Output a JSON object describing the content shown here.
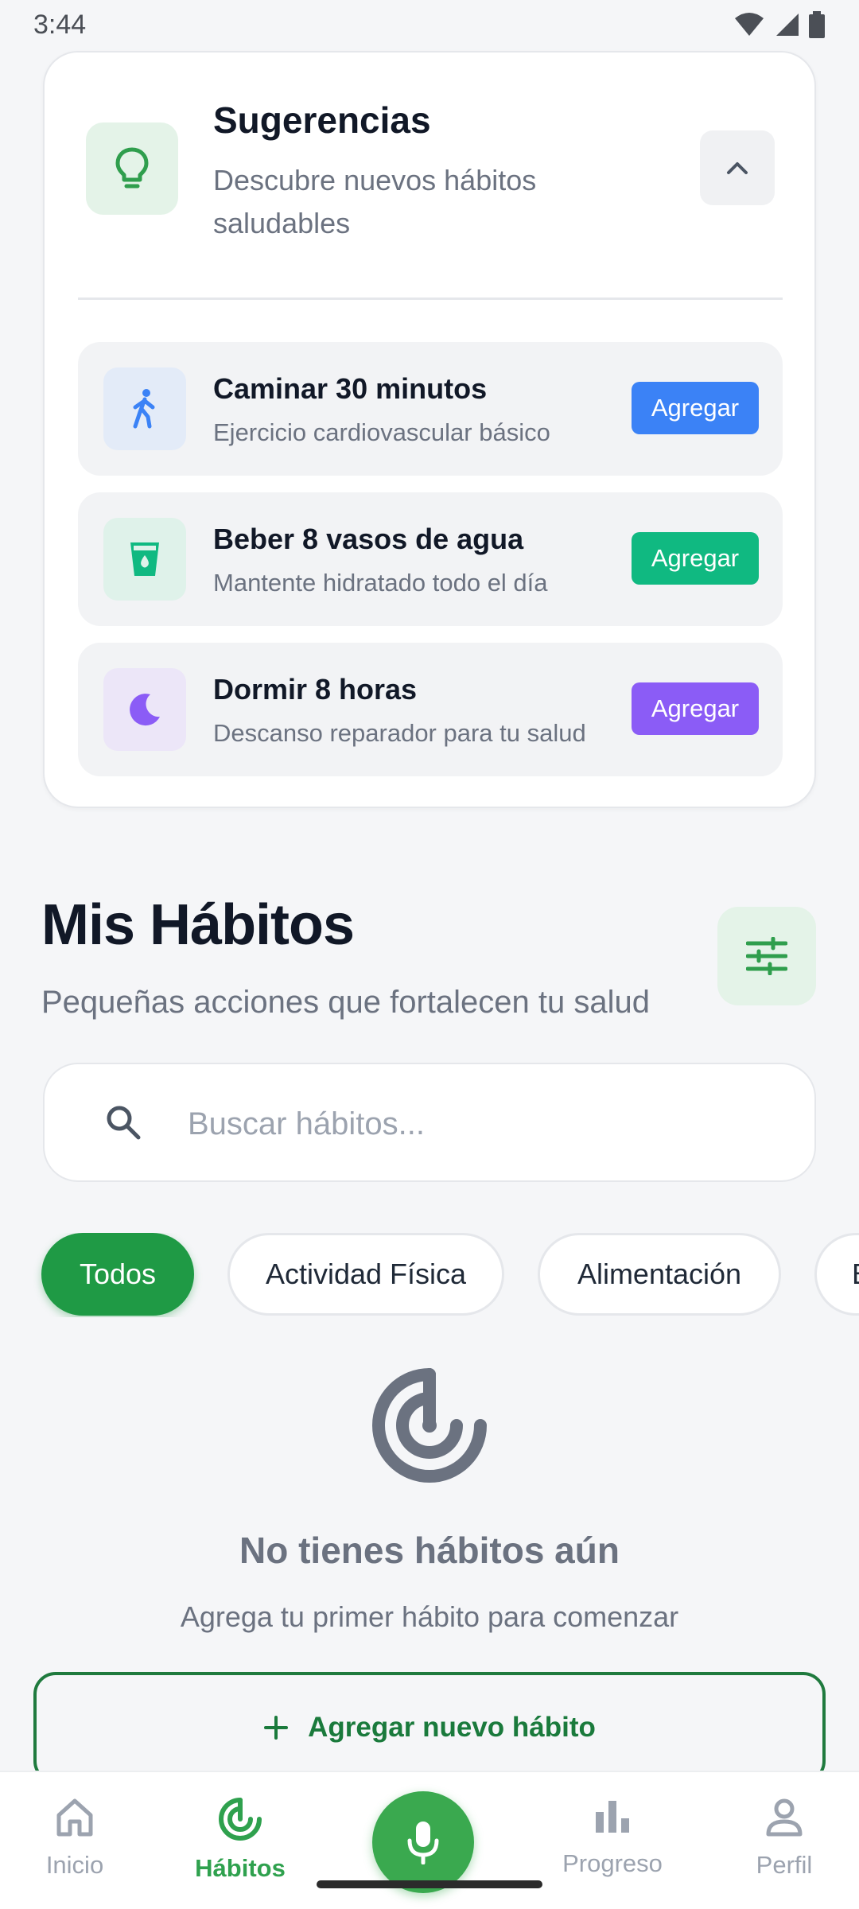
{
  "status_bar": {
    "time": "3:44"
  },
  "suggestions": {
    "title": "Sugerencias",
    "subtitle": "Descubre nuevos hábitos saludables",
    "items": [
      {
        "name": "Caminar 30 minutos",
        "desc": "Ejercicio cardiovascular básico",
        "button": "Agregar",
        "icon": "walking-icon",
        "color": "#3b82f6",
        "bg": "#e3ebf8"
      },
      {
        "name": "Beber 8 vasos de agua",
        "desc": "Mantente hidratado todo el día",
        "button": "Agregar",
        "icon": "water-glass-icon",
        "color": "#10b981",
        "bg": "#dff2ea"
      },
      {
        "name": "Dormir 8 horas",
        "desc": "Descanso reparador para tu salud",
        "button": "Agregar",
        "icon": "moon-icon",
        "color": "#8b5cf6",
        "bg": "#ece6f8"
      }
    ]
  },
  "habits": {
    "title": "Mis Hábitos",
    "subtitle": "Pequeñas acciones que fortalecen tu salud",
    "search_placeholder": "Buscar hábitos...",
    "chips": [
      "Todos",
      "Actividad Física",
      "Alimentación",
      "B"
    ],
    "active_chip": "Todos",
    "empty_title": "No tienes hábitos aún",
    "empty_subtitle": "Agrega tu primer hábito para comenzar",
    "add_button": "Agregar nuevo hábito"
  },
  "nav": {
    "items": [
      "Inicio",
      "Hábitos",
      "Progreso",
      "Perfil"
    ],
    "active": "Hábitos"
  },
  "colors": {
    "accent": "#1f9a45",
    "primary_green": "#3aa94f"
  }
}
